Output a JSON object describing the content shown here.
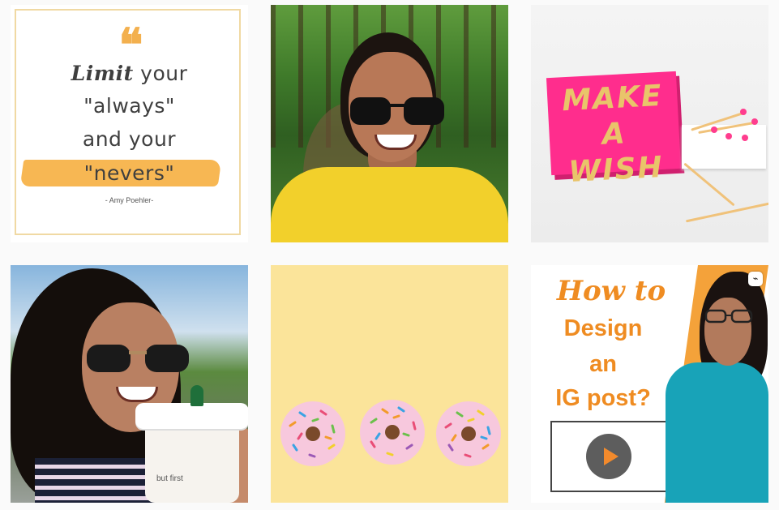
{
  "grid": {
    "posts": [
      {
        "id_label": "quote",
        "quote_mark": "❝",
        "lines": [
          "your",
          "\"always\"",
          "and your",
          "\"nevers\""
        ],
        "lead_word": "Limit",
        "attribution": "- Amy Poehler-",
        "accent_color": "#f7b753"
      },
      {
        "id_label": "forest-selfie"
      },
      {
        "id_label": "make-a-wish",
        "box_text_1": "MAKE",
        "box_text_2": "A WISH",
        "box_color": "#ff2d8d"
      },
      {
        "id_label": "coffee-selfie",
        "cup_text": "but first"
      },
      {
        "id_label": "donuts",
        "background_color": "#fbe49a"
      },
      {
        "id_label": "how-to-video",
        "title_script": "How to",
        "title_2": "Design",
        "title_3": "an",
        "title_4": "IG post?",
        "accent_color": "#ef8c22",
        "badge_icon": "igtv-icon"
      }
    ]
  }
}
